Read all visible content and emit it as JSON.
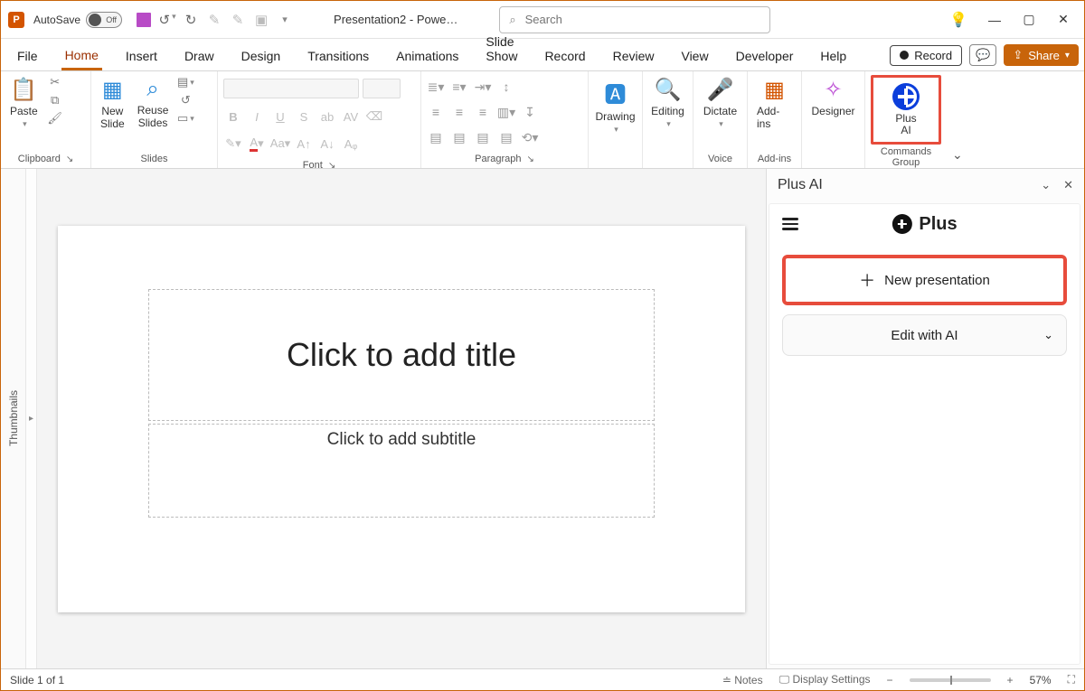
{
  "titlebar": {
    "autosave_label": "AutoSave",
    "autosave_state": "Off",
    "doc_title": "Presentation2  -  Powe…",
    "search_placeholder": "Search"
  },
  "tabs": {
    "items": [
      "File",
      "Home",
      "Insert",
      "Draw",
      "Design",
      "Transitions",
      "Animations",
      "Slide Show",
      "Record",
      "Review",
      "View",
      "Developer",
      "Help"
    ],
    "active_index": 1,
    "record_label": "Record",
    "share_label": "Share"
  },
  "ribbon": {
    "clipboard": {
      "paste": "Paste",
      "label": "Clipboard"
    },
    "slides": {
      "new_slide": "New\nSlide",
      "reuse": "Reuse\nSlides",
      "label": "Slides"
    },
    "font": {
      "label": "Font"
    },
    "paragraph": {
      "label": "Paragraph"
    },
    "drawing": {
      "label": "Drawing"
    },
    "editing": {
      "label": "Editing"
    },
    "voice": {
      "dictate": "Dictate",
      "label": "Voice"
    },
    "addins": {
      "btn": "Add-ins",
      "label": "Add-ins"
    },
    "designer": {
      "btn": "Designer"
    },
    "plusai": {
      "btn_l1": "Plus",
      "btn_l2": "AI",
      "label": "Commands Group"
    }
  },
  "thumbnails_label": "Thumbnails",
  "slide": {
    "title_placeholder": "Click to add title",
    "subtitle_placeholder": "Click to add subtitle"
  },
  "pane": {
    "title": "Plus AI",
    "brand": "Plus",
    "new_presentation": "New presentation",
    "edit_with_ai": "Edit with AI"
  },
  "status": {
    "slide_counter": "Slide 1 of 1",
    "notes": "Notes",
    "display_settings": "Display Settings",
    "zoom_value": "57%"
  }
}
